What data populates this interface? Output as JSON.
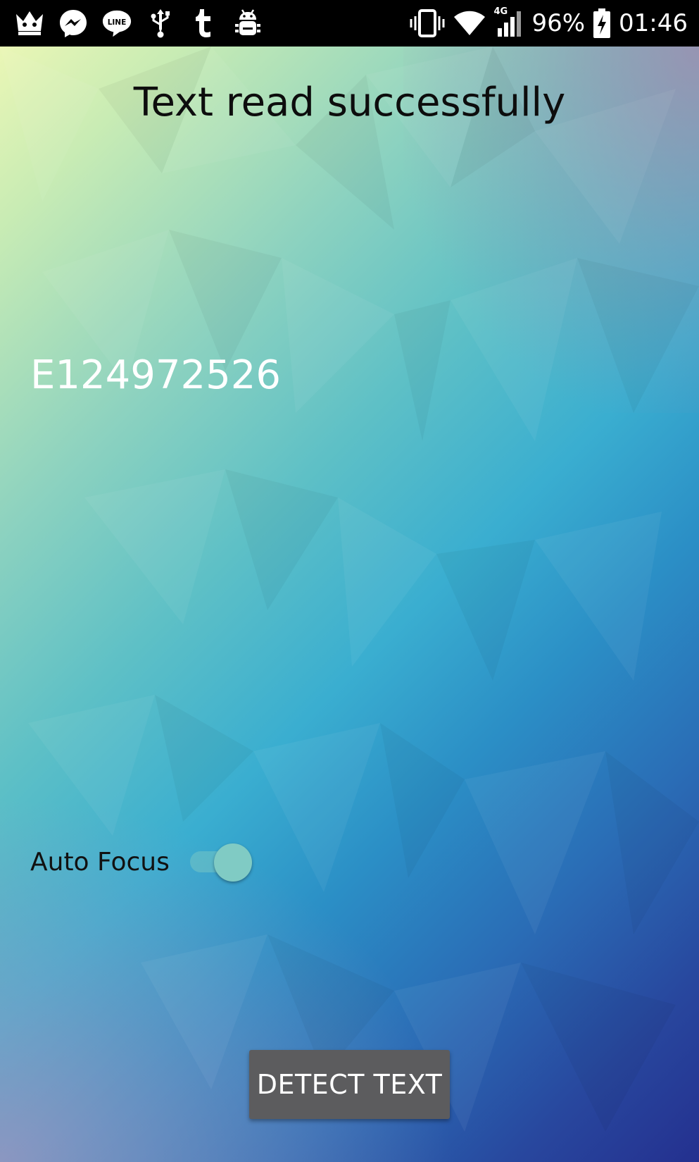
{
  "status_bar": {
    "battery": "96%",
    "time": "01:46",
    "network": "4G",
    "left_icons": [
      "crown-icon",
      "messenger-icon",
      "line-icon",
      "usb-icon",
      "tumblr-icon",
      "android-debug-icon"
    ],
    "right_icons": [
      "vibrate-icon",
      "wifi-icon",
      "signal-icon",
      "battery-charging-icon"
    ]
  },
  "main": {
    "title": "Text read successfully",
    "result_text": "E124972526",
    "auto_focus_label": "Auto Focus",
    "auto_focus_on": true,
    "detect_button_label": "DETECT TEXT"
  },
  "colors": {
    "switch_thumb": "#80cbc4",
    "button_bg": "#5c5c5e",
    "status_bar_bg": "#000000"
  }
}
